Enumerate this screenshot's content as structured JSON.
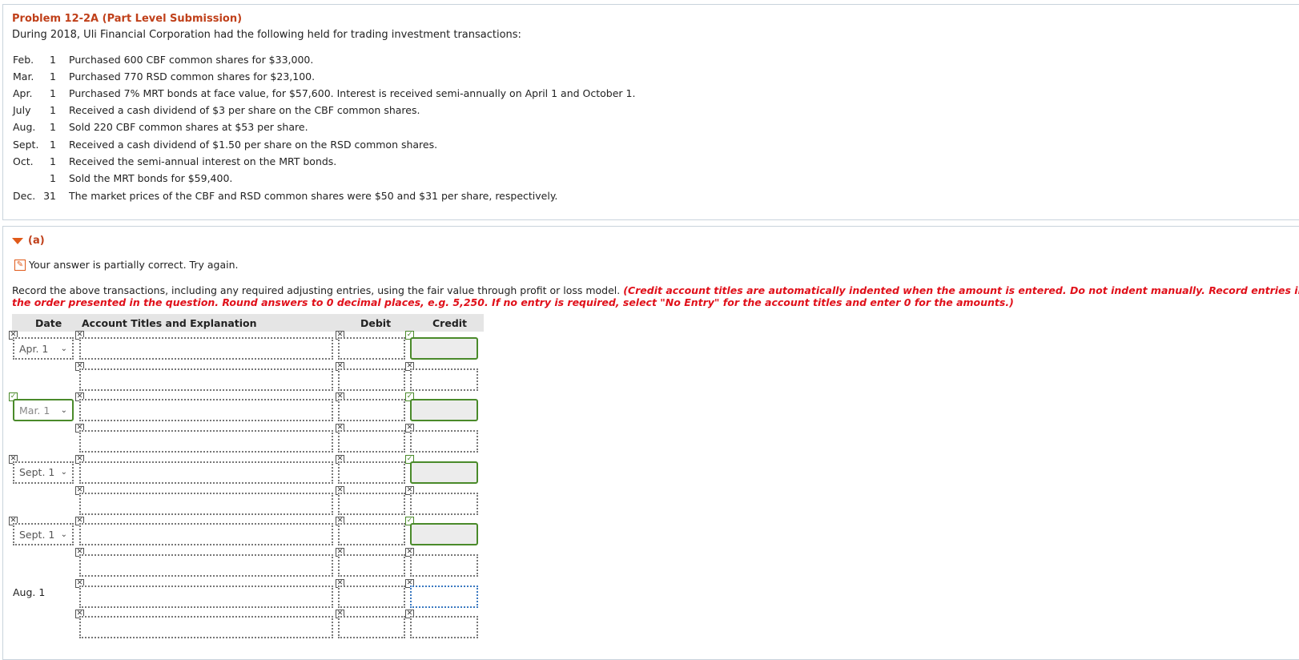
{
  "problem": {
    "title": "Problem 12-2A (Part Level Submission)",
    "intro": "During 2018, Uli Financial Corporation had the following held for trading investment transactions:",
    "transactions": [
      {
        "month": "Feb.",
        "day": "1",
        "desc": "Purchased 600 CBF common shares for $33,000."
      },
      {
        "month": "Mar.",
        "day": "1",
        "desc": "Purchased 770 RSD common shares for $23,100."
      },
      {
        "month": "Apr.",
        "day": "1",
        "desc": "Purchased 7% MRT bonds at face value, for $57,600. Interest is received semi-annually on April 1 and October 1."
      },
      {
        "month": "July",
        "day": "1",
        "desc": "Received a cash dividend of $3 per share on the CBF common shares."
      },
      {
        "month": "Aug.",
        "day": "1",
        "desc": "Sold 220 CBF common shares at $53 per share."
      },
      {
        "month": "Sept.",
        "day": "1",
        "desc": "Received a cash dividend of $1.50 per share on the RSD common shares."
      },
      {
        "month": "Oct.",
        "day": "1",
        "desc": "Received the semi-annual interest on the MRT bonds."
      },
      {
        "month": "",
        "day": "1",
        "desc": "Sold the MRT bonds for $59,400."
      },
      {
        "month": "Dec.",
        "day": "31",
        "desc": "The market prices of the CBF and RSD common shares were $50 and $31 per share, respectively."
      }
    ]
  },
  "part_a": {
    "label": "(a)",
    "feedback": "Your answer is partially correct.  Try again.",
    "instruction_plain": "Record the above transactions, including any required adjusting entries, using the fair value through profit or loss model. ",
    "instruction_red": "(Credit account titles are automatically indented when the amount is entered. Do not indent manually. Record entries in the order presented in the question. Round answers to 0 decimal places, e.g. 5,250. If no entry is required, select \"No Entry\" for the account titles and enter 0 for the amounts.)",
    "table": {
      "headers": {
        "date": "Date",
        "account": "Account Titles and Explanation",
        "debit": "Debit",
        "credit": "Credit"
      },
      "entries": [
        {
          "date": "Apr. 1"
        },
        {
          "date": "Mar. 1"
        },
        {
          "date": "Sept. 1"
        },
        {
          "date": "Sept. 1"
        },
        {
          "date": "Aug. 1"
        }
      ]
    }
  },
  "icons": {
    "x_mark": "✕",
    "check_mark": "✓",
    "chevron": "⌄",
    "edit": "✎"
  }
}
